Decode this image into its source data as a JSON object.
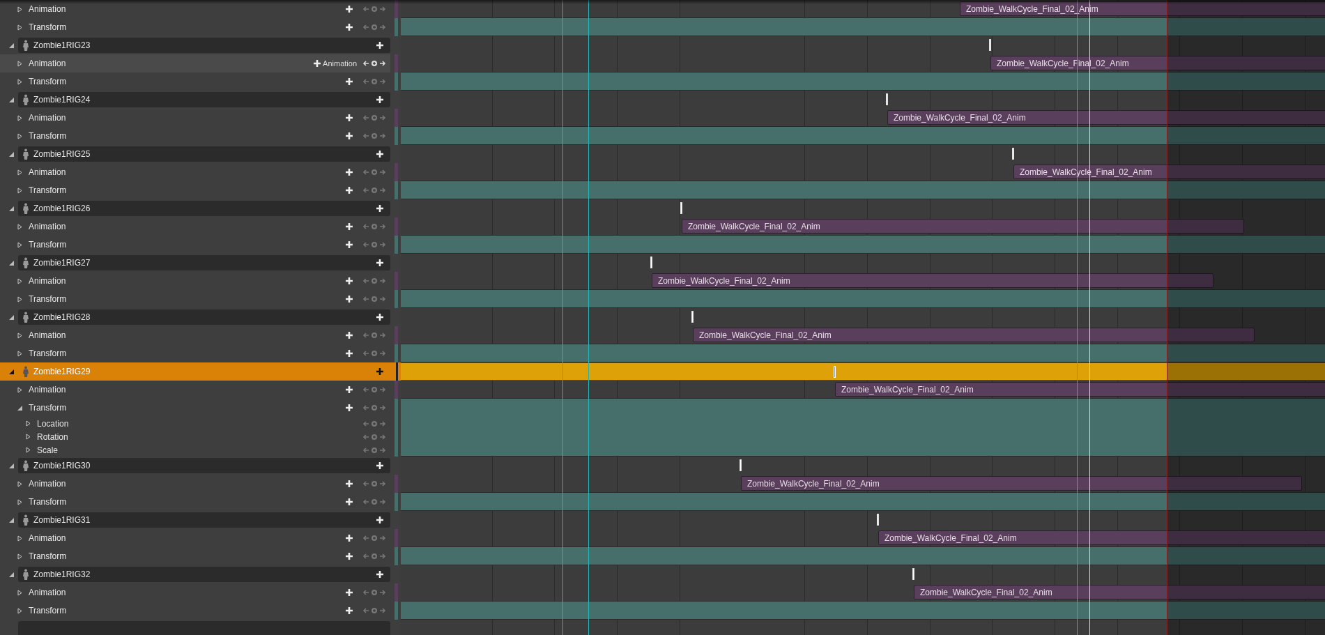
{
  "leading_tracks": [
    {
      "name": "Animation",
      "kind": "animation",
      "expanded": false,
      "hovered": false,
      "section": "Zombie_WalkCycle_Final_02_Anim"
    },
    {
      "name": "Transform",
      "kind": "transform",
      "expanded": false,
      "hovered": false
    }
  ],
  "rigs": [
    {
      "name": "Zombie1RIG23",
      "expanded": true,
      "selected": false,
      "tracks": [
        {
          "name": "Animation",
          "kind": "animation",
          "expanded": false,
          "hovered": true,
          "add_label": "Animation",
          "section": "Zombie_WalkCycle_Final_02_Anim"
        },
        {
          "name": "Transform",
          "kind": "transform",
          "expanded": false,
          "hovered": false
        }
      ]
    },
    {
      "name": "Zombie1RIG24",
      "expanded": true,
      "selected": false,
      "tracks": [
        {
          "name": "Animation",
          "kind": "animation",
          "expanded": false,
          "hovered": false,
          "section": "Zombie_WalkCycle_Final_02_Anim"
        },
        {
          "name": "Transform",
          "kind": "transform",
          "expanded": false,
          "hovered": false
        }
      ]
    },
    {
      "name": "Zombie1RIG25",
      "expanded": true,
      "selected": false,
      "tracks": [
        {
          "name": "Animation",
          "kind": "animation",
          "expanded": false,
          "hovered": false,
          "section": "Zombie_WalkCycle_Final_02_Anim"
        },
        {
          "name": "Transform",
          "kind": "transform",
          "expanded": false,
          "hovered": false
        }
      ]
    },
    {
      "name": "Zombie1RIG26",
      "expanded": true,
      "selected": false,
      "tracks": [
        {
          "name": "Animation",
          "kind": "animation",
          "expanded": false,
          "hovered": false,
          "section": "Zombie_WalkCycle_Final_02_Anim"
        },
        {
          "name": "Transform",
          "kind": "transform",
          "expanded": false,
          "hovered": false
        }
      ]
    },
    {
      "name": "Zombie1RIG27",
      "expanded": true,
      "selected": false,
      "tracks": [
        {
          "name": "Animation",
          "kind": "animation",
          "expanded": false,
          "hovered": false,
          "section": "Zombie_WalkCycle_Final_02_Anim"
        },
        {
          "name": "Transform",
          "kind": "transform",
          "expanded": false,
          "hovered": false
        }
      ]
    },
    {
      "name": "Zombie1RIG28",
      "expanded": true,
      "selected": false,
      "tracks": [
        {
          "name": "Animation",
          "kind": "animation",
          "expanded": false,
          "hovered": false,
          "section": "Zombie_WalkCycle_Final_02_Anim"
        },
        {
          "name": "Transform",
          "kind": "transform",
          "expanded": false,
          "hovered": false
        }
      ]
    },
    {
      "name": "Zombie1RIG29",
      "expanded": true,
      "selected": true,
      "tracks": [
        {
          "name": "Animation",
          "kind": "animation",
          "expanded": false,
          "hovered": false,
          "section": "Zombie_WalkCycle_Final_02_Anim"
        },
        {
          "name": "Transform",
          "kind": "transform",
          "expanded": true,
          "hovered": false,
          "children": [
            {
              "name": "Location",
              "expanded": false
            },
            {
              "name": "Rotation",
              "expanded": false
            },
            {
              "name": "Scale",
              "expanded": false
            }
          ]
        }
      ]
    },
    {
      "name": "Zombie1RIG30",
      "expanded": true,
      "selected": false,
      "tracks": [
        {
          "name": "Animation",
          "kind": "animation",
          "expanded": false,
          "hovered": false,
          "section": "Zombie_WalkCycle_Final_02_Anim"
        },
        {
          "name": "Transform",
          "kind": "transform",
          "expanded": false,
          "hovered": false
        }
      ]
    },
    {
      "name": "Zombie1RIG31",
      "expanded": true,
      "selected": false,
      "tracks": [
        {
          "name": "Animation",
          "kind": "animation",
          "expanded": false,
          "hovered": false,
          "section": "Zombie_WalkCycle_Final_02_Anim"
        },
        {
          "name": "Transform",
          "kind": "transform",
          "expanded": false,
          "hovered": false
        }
      ]
    },
    {
      "name": "Zombie1RIG32",
      "expanded": true,
      "selected": false,
      "tracks": [
        {
          "name": "Animation",
          "kind": "animation",
          "expanded": false,
          "hovered": false,
          "section": "Zombie_WalkCycle_Final_02_Anim"
        },
        {
          "name": "Transform",
          "kind": "transform",
          "expanded": false,
          "hovered": false
        }
      ]
    }
  ]
}
